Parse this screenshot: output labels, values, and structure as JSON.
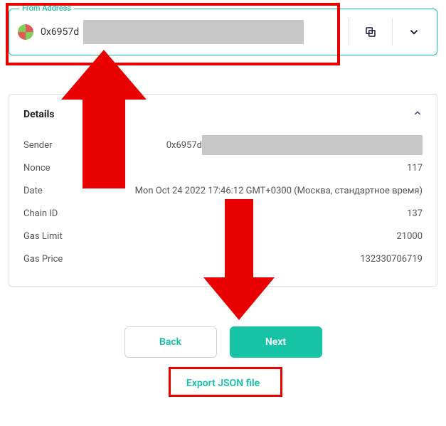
{
  "from_address": {
    "label": "From Address",
    "value_prefix": "0x6957d"
  },
  "details": {
    "title": "Details",
    "rows": {
      "sender": {
        "label": "Sender",
        "value_prefix": "0x6957d"
      },
      "nonce": {
        "label": "Nonce",
        "value": "117"
      },
      "date": {
        "label": "Date",
        "value": "Mon Oct 24 2022 17:46:12 GMT+0300 (Москва, стандартное время)"
      },
      "chain_id": {
        "label": "Chain ID",
        "value": "137"
      },
      "gas_limit": {
        "label": "Gas Limit",
        "value": "21000"
      },
      "gas_price": {
        "label": "Gas Price",
        "value": "132330706719"
      }
    }
  },
  "buttons": {
    "back": "Back",
    "next": "Next",
    "export": "Export JSON file"
  }
}
